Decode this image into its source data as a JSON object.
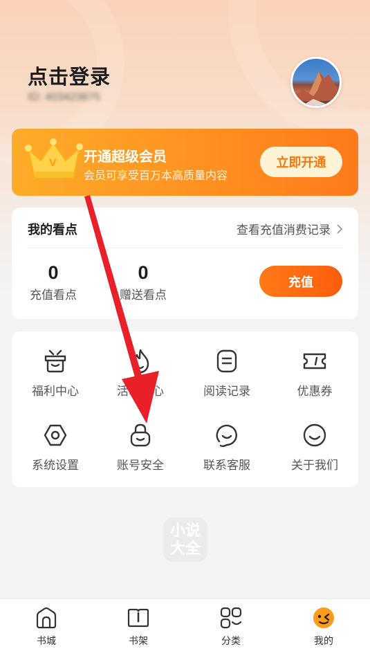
{
  "header": {
    "login_text": "点击登录",
    "user_id": "ID: 403423675"
  },
  "vip": {
    "title": "开通超级会员",
    "subtitle": "会员可享受百万本高质量内容",
    "button": "立即开通"
  },
  "points": {
    "title": "我的看点",
    "records_link": "查看充值消费记录",
    "recharge_points_value": "0",
    "recharge_points_label": "充值看点",
    "gift_points_value": "0",
    "gift_points_label": "赠送看点",
    "recharge_button": "充值"
  },
  "menu": {
    "items": [
      {
        "label": "福利中心",
        "icon": "gift-box-icon"
      },
      {
        "label": "活动中心",
        "icon": "flame-icon"
      },
      {
        "label": "阅读记录",
        "icon": "reading-record-icon"
      },
      {
        "label": "优惠券",
        "icon": "coupon-icon"
      },
      {
        "label": "系统设置",
        "icon": "settings-icon"
      },
      {
        "label": "账号安全",
        "icon": "lock-icon"
      },
      {
        "label": "联系客服",
        "icon": "customer-service-icon"
      },
      {
        "label": "关于我们",
        "icon": "smile-icon"
      }
    ]
  },
  "watermark": {
    "line1": "小说",
    "line2": "大全"
  },
  "tabbar": {
    "items": [
      {
        "label": "书城",
        "icon": "home-icon"
      },
      {
        "label": "书架",
        "icon": "bookshelf-icon"
      },
      {
        "label": "分类",
        "icon": "category-icon"
      },
      {
        "label": "我的",
        "icon": "profile-icon"
      }
    ]
  },
  "colors": {
    "accent": "#ff6a10",
    "vip_gradient_start": "#ffac2a",
    "vip_gradient_end": "#ff7a1a",
    "annotation_arrow": "#e8202a"
  }
}
